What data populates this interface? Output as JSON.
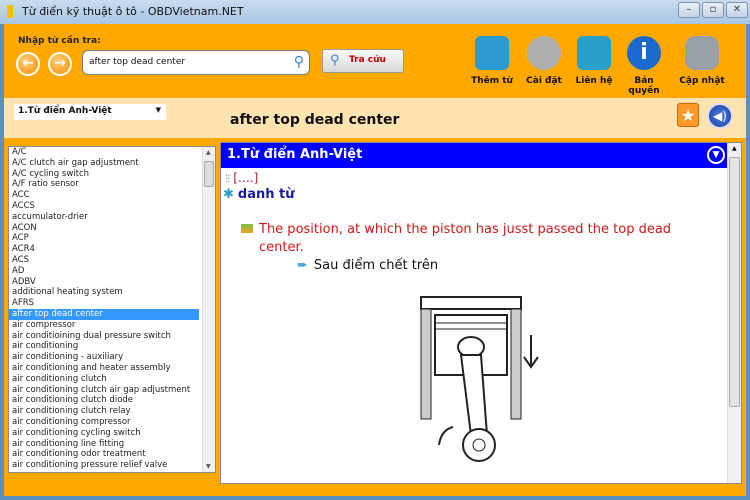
{
  "window": {
    "title": "Từ điển kỹ thuật ô tô - OBDVietnam.NET"
  },
  "toolbar": {
    "search_label": "Nhập từ cần tra:",
    "search_value": "after top dead center",
    "lookup_button": "Tra cứu",
    "tools": [
      {
        "label": "Thêm từ",
        "icon": "add-book-icon",
        "color": "#2a9ad0"
      },
      {
        "label": "Cài đặt",
        "icon": "settings-tools-icon",
        "color": "#b0b0b0"
      },
      {
        "label": "Liên hệ",
        "icon": "envelope-icon",
        "color": "#2aa0c8"
      },
      {
        "label": "Bản quyền",
        "icon": "info-icon",
        "color": "#1a6ad0"
      },
      {
        "label": "Cập nhật",
        "icon": "database-download-icon",
        "color": "#9aa0a8"
      }
    ]
  },
  "dictionary_select": {
    "value": "1.Từ điển Anh-Việt"
  },
  "current_word": "after top dead center",
  "word_list": {
    "selected": "after top dead center",
    "items": [
      "A/C",
      "A/C clutch air gap adjustment",
      "A/C cycling switch",
      "A/F ratio sensor",
      "ACC",
      "ACCS",
      "accumulator-drier",
      "ACON",
      "ACP",
      "ACR4",
      "ACS",
      "AD",
      "ADBV",
      "additional heating system",
      "AFRS",
      "after top dead center",
      "air compressor",
      "air conditioining dual pressure switch",
      "air conditioning",
      "air conditioning - auxiliary",
      "air conditioning and heater assembly",
      "air conditioning clutch",
      "air conditioning clutch air gap adjustment",
      "air conditioning clutch diode",
      "air conditioning clutch relay",
      "air conditioning compressor",
      "air conditioning cycling switch",
      "air conditioning line fitting",
      "air conditioning odor treatment",
      "air conditioning pressure relief valve"
    ]
  },
  "entry": {
    "dictionary": "1.Từ điển Anh-Việt",
    "pronunciation": "[….]",
    "part_of_speech": "danh từ",
    "definition": "The position, at which the piston has jusst passed the top dead center.",
    "translation": "Sau điểm chết trên"
  },
  "colors": {
    "app_bg": "#ffa800",
    "header_bar": "#0000ff",
    "selection": "#3399ff",
    "definition": "#d01818"
  }
}
